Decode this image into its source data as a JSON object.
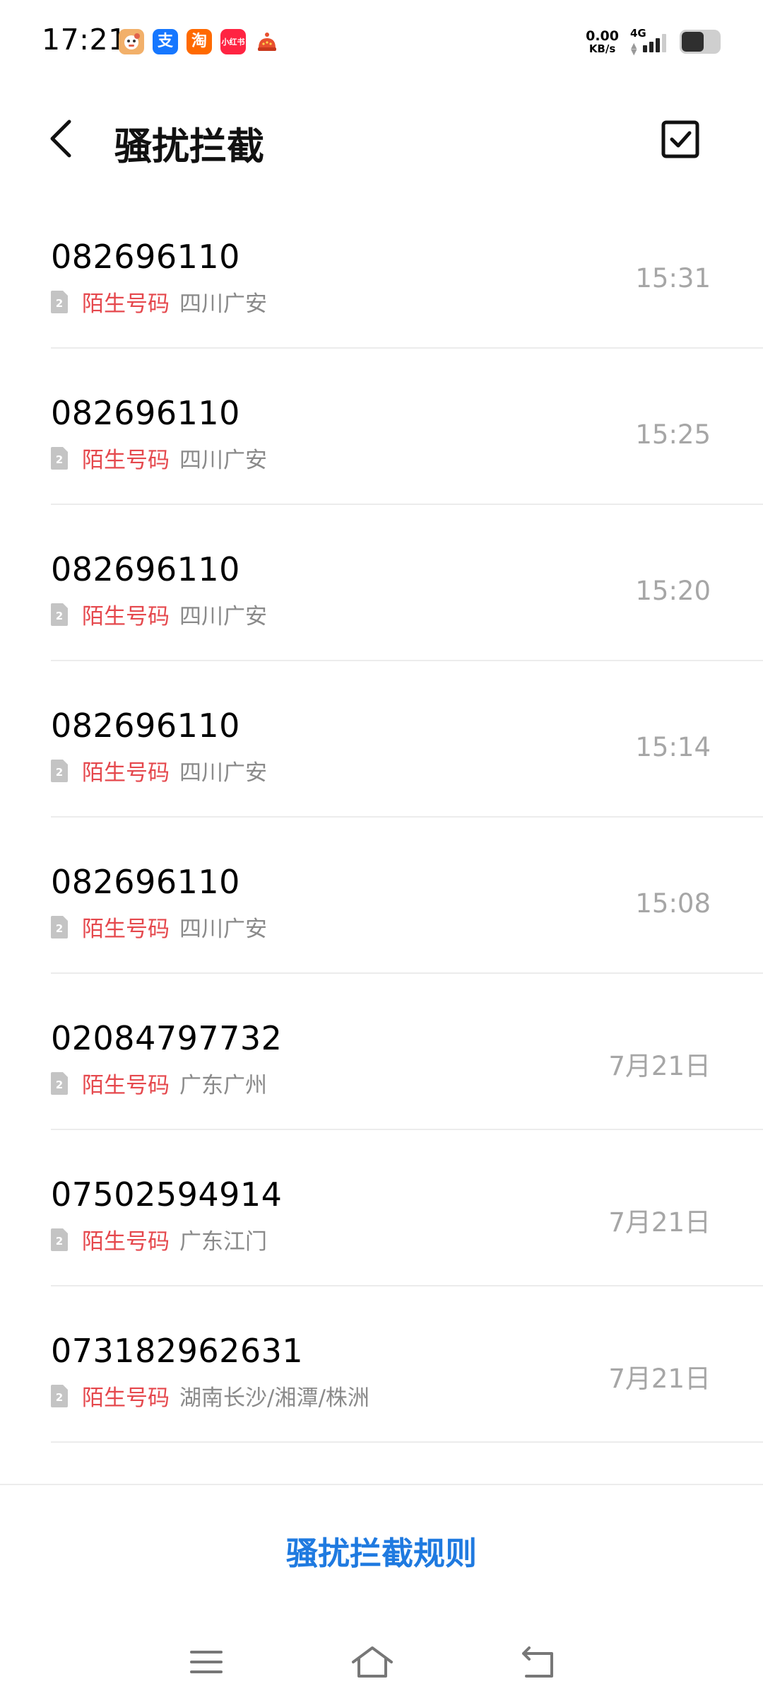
{
  "status_bar": {
    "time": "17:21",
    "apps": [
      {
        "name": "cartoon-app-icon",
        "glyph": "◉",
        "color": "#f2b06a"
      },
      {
        "name": "alipay-icon",
        "glyph": "支",
        "color": "#1677ff"
      },
      {
        "name": "taobao-icon",
        "glyph": "淘",
        "color": "#ff6a00"
      },
      {
        "name": "xiaohongshu-icon",
        "glyph": "小红书",
        "color": "#ff2442"
      },
      {
        "name": "red-app-icon",
        "glyph": "●",
        "color": "#e8502e"
      }
    ],
    "net_speed_value": "0.00",
    "net_speed_unit": "KB/s",
    "network_type": "4G",
    "battery_level": 0.6
  },
  "header": {
    "title": "骚扰拦截"
  },
  "calls": [
    {
      "number": "082696110",
      "tag": "陌生号码",
      "location": "四川广安",
      "time": "15:31",
      "sim": "2"
    },
    {
      "number": "082696110",
      "tag": "陌生号码",
      "location": "四川广安",
      "time": "15:25",
      "sim": "2"
    },
    {
      "number": "082696110",
      "tag": "陌生号码",
      "location": "四川广安",
      "time": "15:20",
      "sim": "2"
    },
    {
      "number": "082696110",
      "tag": "陌生号码",
      "location": "四川广安",
      "time": "15:14",
      "sim": "2"
    },
    {
      "number": "082696110",
      "tag": "陌生号码",
      "location": "四川广安",
      "time": "15:08",
      "sim": "2"
    },
    {
      "number": "02084797732",
      "tag": "陌生号码",
      "location": "广东广州",
      "time": "7月21日",
      "sim": "2"
    },
    {
      "number": "07502594914",
      "tag": "陌生号码",
      "location": "广东江门",
      "time": "7月21日",
      "sim": "2"
    },
    {
      "number": "073182962631",
      "tag": "陌生号码",
      "location": "湖南长沙/湘潭/株洲",
      "time": "7月21日",
      "sim": "2"
    }
  ],
  "footer": {
    "rule_button_label": "骚扰拦截规则"
  },
  "colors": {
    "accent": "#1f7ae0",
    "stranger_tag": "#e5484d",
    "secondary_text": "#8a8a8a"
  },
  "nav_icons": [
    "menu-icon",
    "home-icon",
    "back-icon"
  ]
}
